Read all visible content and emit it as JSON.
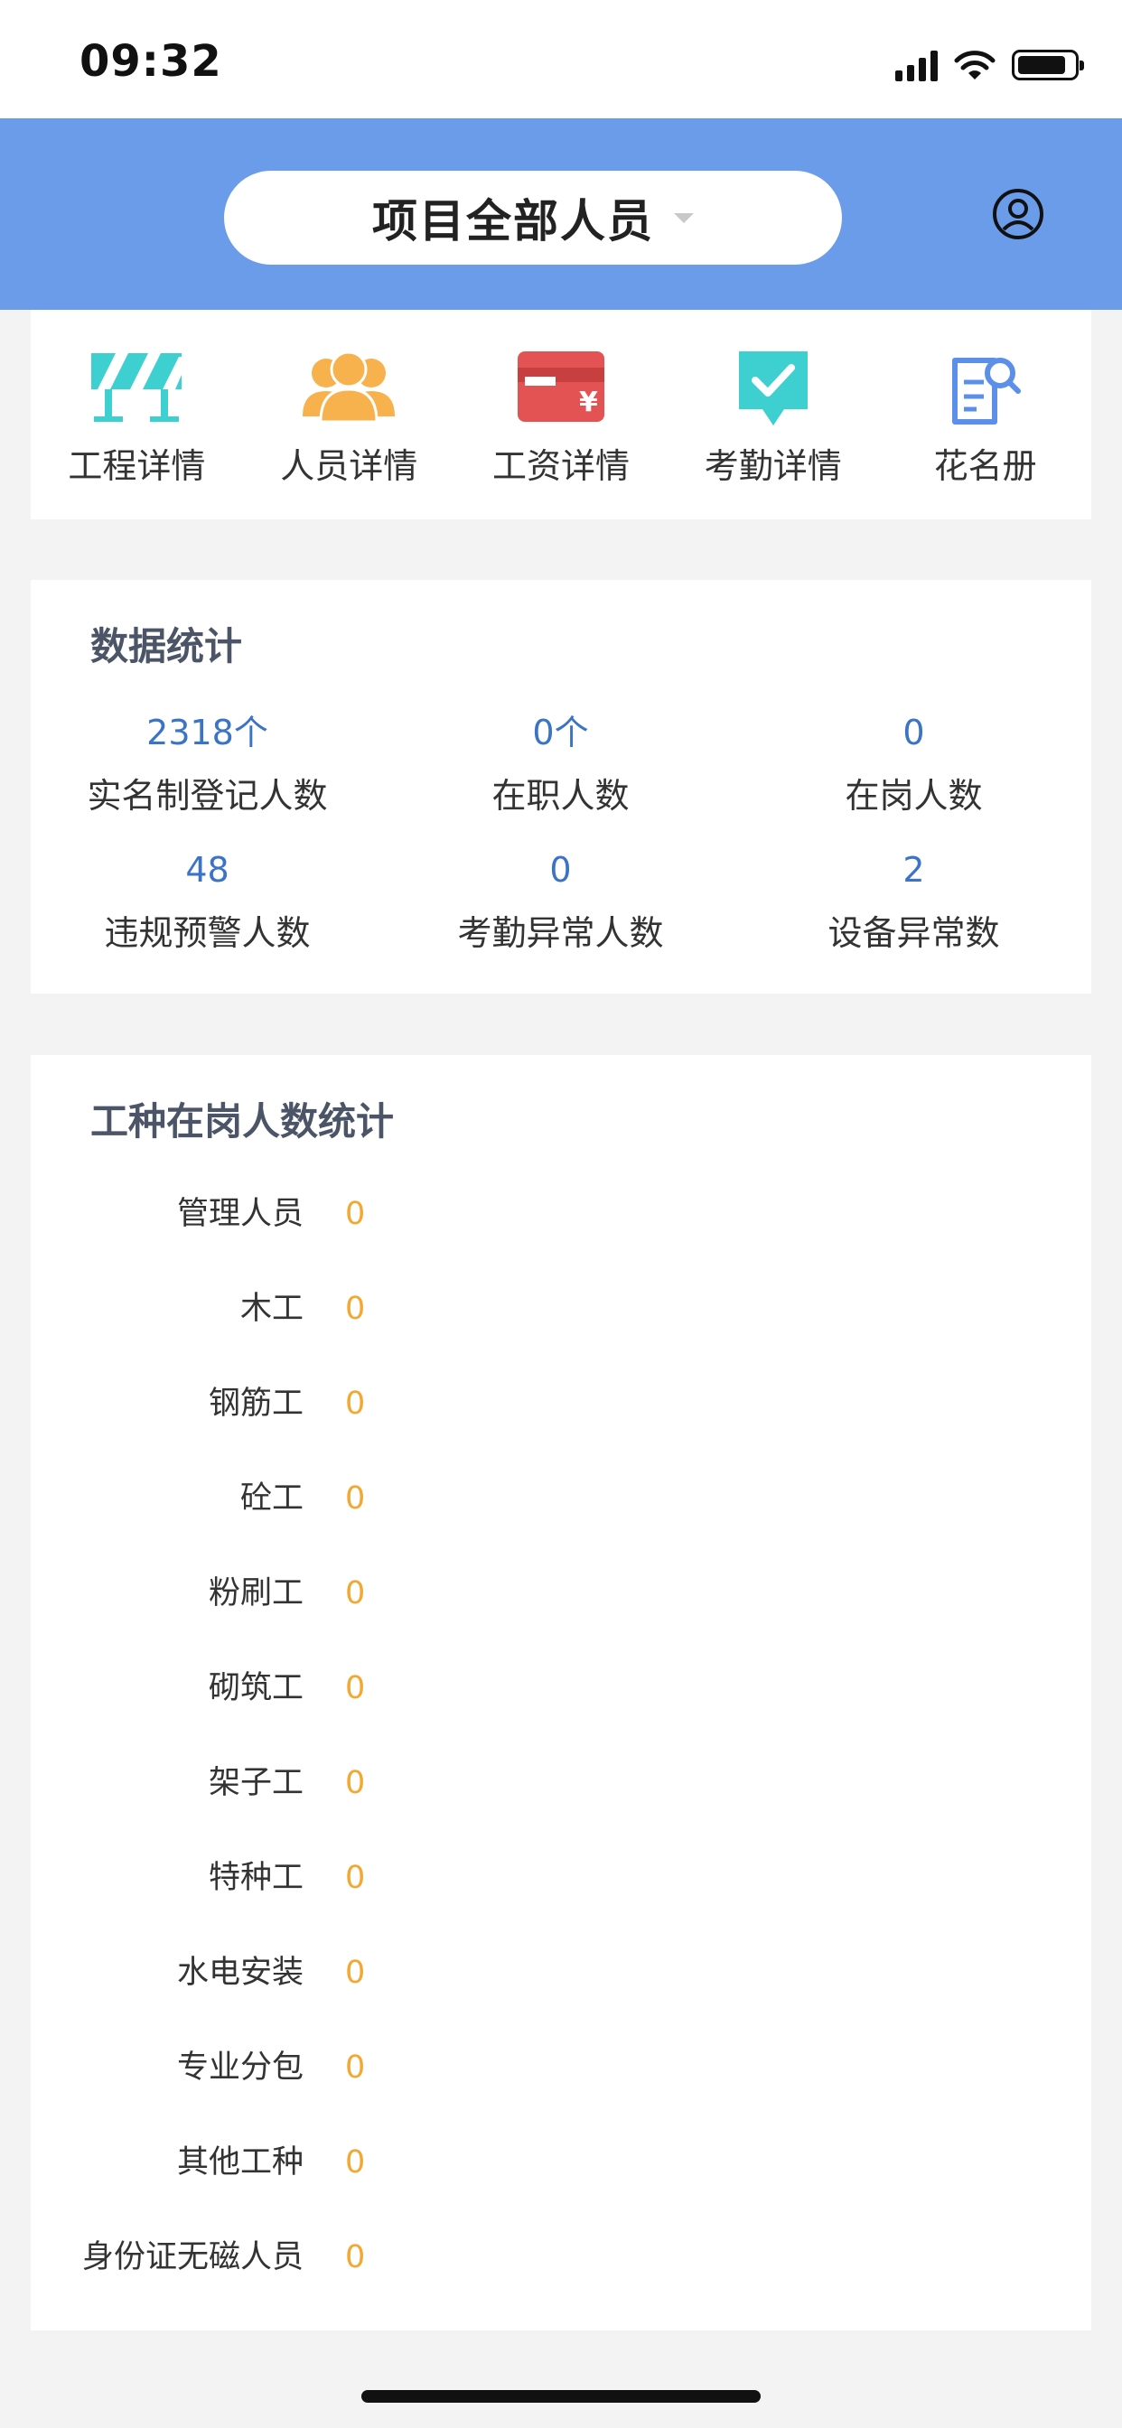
{
  "status_bar": {
    "time": "09:32"
  },
  "header": {
    "selector_label": "项目全部人员",
    "accent_color": "#6b9cea",
    "user_icon": "user-circle-icon"
  },
  "quick_menu": [
    {
      "label": "工程详情",
      "icon": "barrier-icon",
      "color": "#3ecfd0"
    },
    {
      "label": "人员详情",
      "icon": "people-icon",
      "color": "#f8b24d"
    },
    {
      "label": "工资详情",
      "icon": "salary-card-icon",
      "color": "#e35353"
    },
    {
      "label": "考勤详情",
      "icon": "attendance-check-icon",
      "color": "#3ecfd0"
    },
    {
      "label": "花名册",
      "icon": "roster-icon",
      "color": "#5b8fe8"
    }
  ],
  "stats": {
    "title": "数据统计",
    "items": [
      {
        "value": "2318个",
        "label": "实名制登记人数"
      },
      {
        "value": "0个",
        "label": "在职人数"
      },
      {
        "value": "0",
        "label": "在岗人数"
      },
      {
        "value": "48",
        "label": "违规预警人数"
      },
      {
        "value": "0",
        "label": "考勤异常人数"
      },
      {
        "value": "2",
        "label": "设备异常数"
      }
    ]
  },
  "work_types": {
    "title": "工种在岗人数统计",
    "rows": [
      {
        "label": "管理人员",
        "value": "0"
      },
      {
        "label": "木工",
        "value": "0"
      },
      {
        "label": "钢筋工",
        "value": "0"
      },
      {
        "label": "砼工",
        "value": "0"
      },
      {
        "label": "粉刷工",
        "value": "0"
      },
      {
        "label": "砌筑工",
        "value": "0"
      },
      {
        "label": "架子工",
        "value": "0"
      },
      {
        "label": "特种工",
        "value": "0"
      },
      {
        "label": "水电安装",
        "value": "0"
      },
      {
        "label": "专业分包",
        "value": "0"
      },
      {
        "label": "其他工种",
        "value": "0"
      },
      {
        "label": "身份证无磁人员",
        "value": "0"
      }
    ]
  }
}
